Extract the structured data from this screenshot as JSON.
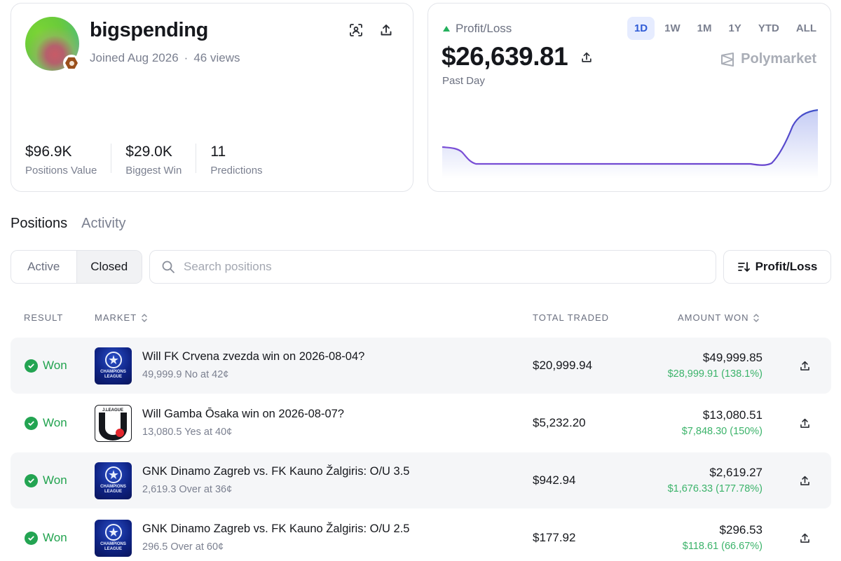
{
  "profile": {
    "username": "bigspending",
    "joined": "Joined Aug 2026",
    "views": "46 views",
    "stats": [
      {
        "value": "$96.9K",
        "label": "Positions Value"
      },
      {
        "value": "$29.0K",
        "label": "Biggest Win"
      },
      {
        "value": "11",
        "label": "Predictions"
      }
    ]
  },
  "pnl": {
    "label": "Profit/Loss",
    "value": "$26,639.81",
    "period": "Past Day",
    "ranges": [
      "1D",
      "1W",
      "1M",
      "1Y",
      "YTD",
      "ALL"
    ],
    "active_range": "1D",
    "brand": "Polymarket",
    "trend_color": "#23b05c",
    "line_color": "#5b3fd0"
  },
  "tabs": [
    "Positions",
    "Activity"
  ],
  "filter": {
    "segments": [
      "Active",
      "Closed"
    ],
    "selected": "Closed",
    "search_placeholder": "Search positions",
    "sort_label": "Profit/Loss"
  },
  "table": {
    "headers": {
      "result": "RESULT",
      "market": "MARKET",
      "traded": "TOTAL TRADED",
      "won": "AMOUNT WON"
    },
    "rows": [
      {
        "result": "Won",
        "logo": "champions-league-logo",
        "title": "Will FK Crvena zvezda win on 2026-08-04?",
        "sub": "49,999.9 No at 42¢",
        "traded": "$20,999.94",
        "won": "$49,999.85",
        "gain": "$28,999.91 (138.1%)"
      },
      {
        "result": "Won",
        "logo": "j-league-logo",
        "title": "Will Gamba Ōsaka win on 2026-08-07?",
        "sub": "13,080.5 Yes at 40¢",
        "traded": "$5,232.20",
        "won": "$13,080.51",
        "gain": "$7,848.30 (150%)"
      },
      {
        "result": "Won",
        "logo": "champions-league-logo",
        "title": "GNK Dinamo Zagreb vs. FK Kauno Žalgiris: O/U 3.5",
        "sub": "2,619.3 Over at 36¢",
        "traded": "$942.94",
        "won": "$2,619.27",
        "gain": "$1,676.33 (177.78%)"
      },
      {
        "result": "Won",
        "logo": "champions-league-logo",
        "title": "GNK Dinamo Zagreb vs. FK Kauno Žalgiris: O/U 2.5",
        "sub": "296.5 Over at 60¢",
        "traded": "$177.92",
        "won": "$296.53",
        "gain": "$118.61 (66.67%)"
      }
    ],
    "logo_text": {
      "champions_league": [
        "CHAMPIONS",
        "LEAGUE"
      ],
      "j_league": "J.LEAGUE"
    }
  }
}
